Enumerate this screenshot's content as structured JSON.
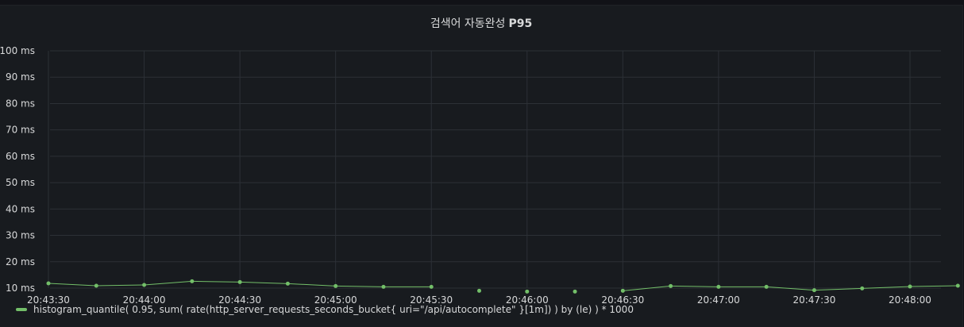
{
  "panel": {
    "title_text": "검색어 자동완성",
    "title_suffix": "P95"
  },
  "colors": {
    "series": "#73bf69",
    "grid": "#2c3036",
    "background": "#181b1f"
  },
  "chart_data": {
    "type": "line",
    "title": "검색어 자동완성 P95",
    "ylim": [
      10,
      100
    ],
    "y_ticks": [
      100,
      90,
      80,
      70,
      60,
      50,
      40,
      30,
      20,
      10
    ],
    "y_tick_labels": [
      "100 ms",
      "90 ms",
      "80 ms",
      "70 ms",
      "60 ms",
      "50 ms",
      "40 ms",
      "30 ms",
      "20 ms",
      "10 ms"
    ],
    "x_range": [
      "20:43:30",
      "20:48:15"
    ],
    "x_ticks": [
      "20:43:30",
      "20:44:00",
      "20:44:30",
      "20:45:00",
      "20:45:30",
      "20:46:00",
      "20:46:30",
      "20:47:00",
      "20:47:30",
      "20:48:00"
    ],
    "grid": true,
    "legend_position": "bottom-left",
    "series": [
      {
        "name": "histogram_quantile( 0.95, sum( rate(http_server_requests_seconds_bucket{ uri=\"/api/autocomplete\" }[1m]) ) by (le) ) * 1000",
        "x": [
          "20:43:30",
          "20:43:45",
          "20:44:00",
          "20:44:15",
          "20:44:30",
          "20:44:45",
          "20:45:00",
          "20:45:15",
          "20:45:30",
          "20:45:45",
          "20:46:00",
          "20:46:15",
          "20:46:30",
          "20:46:45",
          "20:47:00",
          "20:47:15",
          "20:47:30",
          "20:47:45",
          "20:48:00",
          "20:48:15"
        ],
        "values": [
          11.8,
          10.9,
          11.2,
          12.6,
          12.3,
          11.7,
          10.8,
          10.5,
          10.5,
          9.0,
          8.7,
          8.7,
          9.0,
          10.8,
          10.5,
          10.5,
          9.2,
          9.9,
          10.6,
          10.9
        ],
        "connected": [
          true,
          true,
          true,
          true,
          true,
          true,
          true,
          true,
          false,
          false,
          false,
          false,
          true,
          true,
          true,
          true,
          true,
          true,
          true
        ]
      }
    ]
  }
}
